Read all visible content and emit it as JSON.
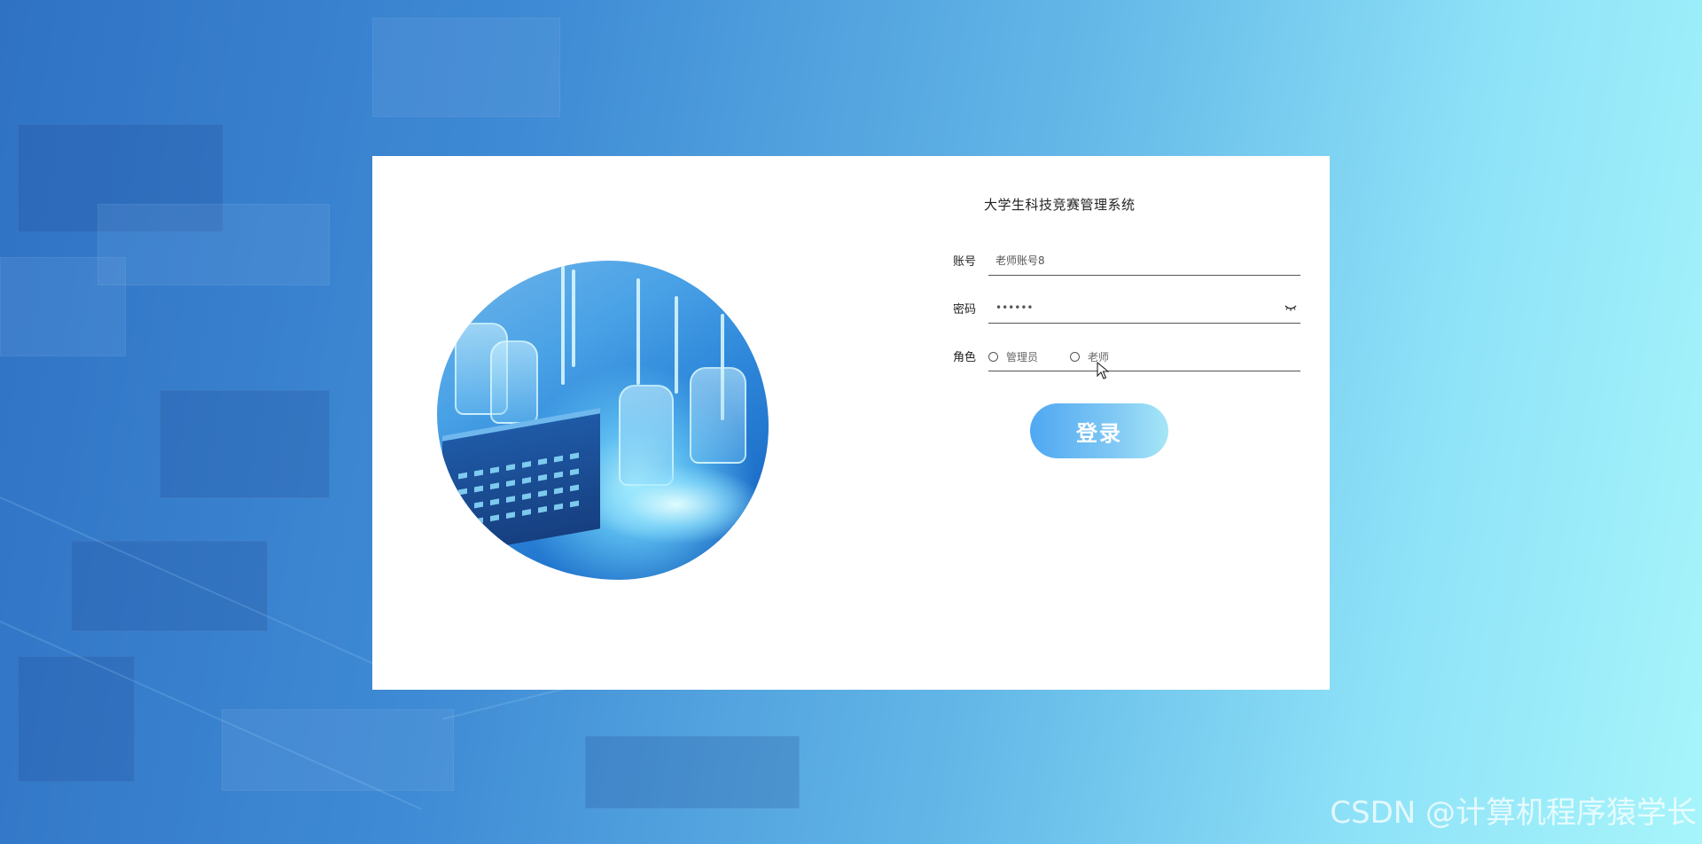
{
  "app": {
    "title": "大学生科技竞赛管理系统"
  },
  "form": {
    "account": {
      "label": "账号",
      "value": "老师账号8"
    },
    "password": {
      "label": "密码",
      "value": "123456",
      "toggle_icon": "eye-closed-icon"
    },
    "role": {
      "label": "角色",
      "options": [
        {
          "label": "管理员",
          "selected": false
        },
        {
          "label": "老师",
          "selected": false
        }
      ]
    },
    "submit_label": "登录"
  },
  "watermark": "CSDN @计算机程序猿学长",
  "colors": {
    "background_start": "#2f72c4",
    "background_end": "#a7f5fb",
    "button_start": "#4fa8f2",
    "button_end": "#a6e6f6"
  }
}
